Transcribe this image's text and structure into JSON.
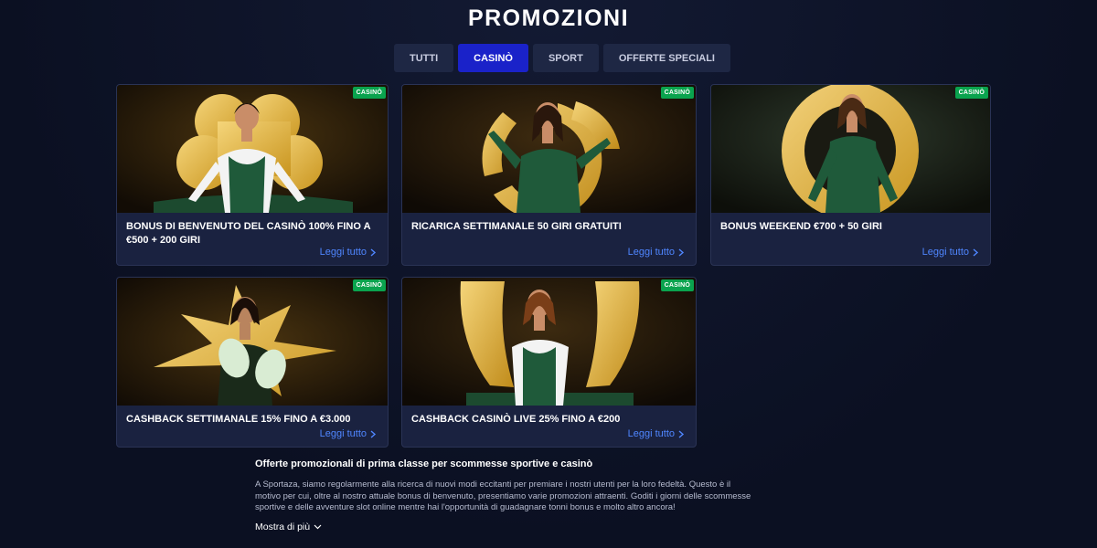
{
  "page": {
    "title": "PROMOZIONI"
  },
  "tabs": [
    {
      "label": "TUTTI",
      "active": false
    },
    {
      "label": "CASINÒ",
      "active": true
    },
    {
      "label": "SPORT",
      "active": false
    },
    {
      "label": "OFFERTE SPECIALI",
      "active": false
    }
  ],
  "cards": [
    {
      "badge": "CASINÒ",
      "title": "BONUS DI BENVENUTO DEL CASINÒ 100% FINO A €500 + 200 GIRI",
      "link": "Leggi tutto",
      "motif": "clover-icon"
    },
    {
      "badge": "CASINÒ",
      "title": "RICARICA SETTIMANALE 50 GIRI GRATUITI",
      "link": "Leggi tutto",
      "motif": "spiral-icon"
    },
    {
      "badge": "CASINÒ",
      "title": "BONUS WEEKEND €700 + 50 GIRI",
      "link": "Leggi tutto",
      "motif": "circle-icon"
    },
    {
      "badge": "CASINÒ",
      "title": "CASHBACK SETTIMANALE 15% FINO A €3.000",
      "link": "Leggi tutto",
      "motif": "starburst-icon"
    },
    {
      "badge": "CASINÒ",
      "title": "CASHBACK CASINÒ LIVE 25% FINO A €200",
      "link": "Leggi tutto",
      "motif": "wings-icon"
    }
  ],
  "seo": {
    "title": "Offerte promozionali di prima classe per scommesse sportive e casinò",
    "text": "A Sportaza, siamo regolarmente alla ricerca di nuovi modi eccitanti per premiare i nostri utenti per la loro fedeltà. Questo è il motivo per cui, oltre al nostro attuale bonus di benvenuto, presentiamo varie promozioni attraenti. Goditi i giorni delle scommesse sportive e delle avventure slot online mentre hai l'opportunità di guadagnare tonni bonus e molto altro ancora!",
    "more": "Mostra di più"
  },
  "colors": {
    "accent": "#1a22c9",
    "link": "#4f86ff",
    "badge": "#0aa34e",
    "gold": "#e8b93a",
    "dress": "#1f5a3a"
  }
}
